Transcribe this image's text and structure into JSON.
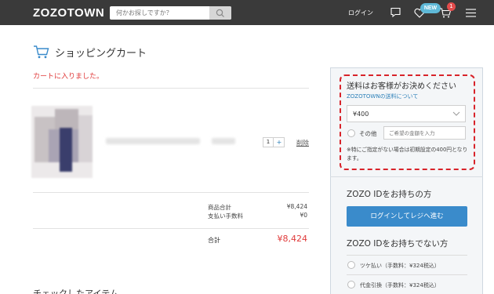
{
  "header": {
    "logo": "ZOZOTOWN",
    "search_placeholder": "何かお探しですか？",
    "login_label": "ログイン",
    "new_badge": "NEW",
    "cart_count": "1",
    "icons": [
      "search-icon",
      "message-icon",
      "heart-icon",
      "cart-icon",
      "menu-icon"
    ],
    "bg_color": "#3a3a3a"
  },
  "page": {
    "title": "ショッピングカート",
    "added_message": "カートに入りました。",
    "checked_items_heading": "チェックしたアイテム"
  },
  "cart_item": {
    "quantity": "1",
    "plus_label": "+",
    "delete_label": "削除"
  },
  "summary": {
    "subtotal_label": "商品合計",
    "subtotal_value": "¥8,424",
    "fee_label": "支払い手数料",
    "fee_value": "¥0",
    "total_label": "合計",
    "total_value": "¥8,424"
  },
  "shipping": {
    "title": "送料はお客様がお決めください",
    "about_link": "ZOZOTOWNの送料について",
    "selected_value": "¥400",
    "other_label": "その他",
    "other_placeholder": "ご希望の金額を入力",
    "note": "※特にご指定がない場合は初期設定の400円となります。"
  },
  "zozo_id": {
    "has_id_heading": "ZOZO IDをお持ちの方",
    "login_button": "ログインしてレジへ進む",
    "no_id_heading": "ZOZO IDをお持ちでない方",
    "payment_options": [
      {
        "label": "ツケ払い（手数料：¥324税込）"
      },
      {
        "label": "代金引換（手数料：¥324税込）"
      }
    ]
  },
  "colors": {
    "accent_blue": "#3a8bcb",
    "price_red": "#e03a3a",
    "highlight_border": "#d8232a",
    "new_badge": "#5fb9d8"
  }
}
